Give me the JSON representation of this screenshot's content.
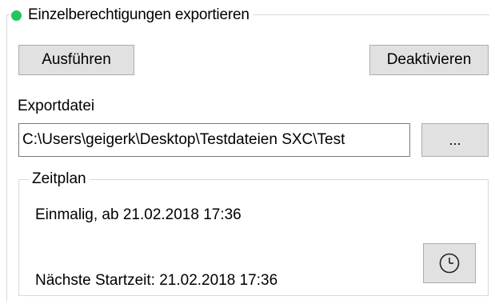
{
  "group": {
    "title": "Einzelberechtigungen exportieren",
    "status_color": "#22c55e",
    "status_icon": "status-dot-green"
  },
  "buttons": {
    "run_label": "Ausführen",
    "deactivate_label": "Deaktivieren",
    "browse_label": "...",
    "schedule_icon": "clock-icon"
  },
  "export": {
    "label": "Exportdatei",
    "path_value": "C:\\Users\\geigerk\\Desktop\\Testdateien SXC\\Test"
  },
  "schedule": {
    "title": "Zeitplan",
    "recurrence": "Einmalig, ab 21.02.2018 17:36",
    "next_start": "Nächste Startzeit: 21.02.2018 17:36"
  }
}
